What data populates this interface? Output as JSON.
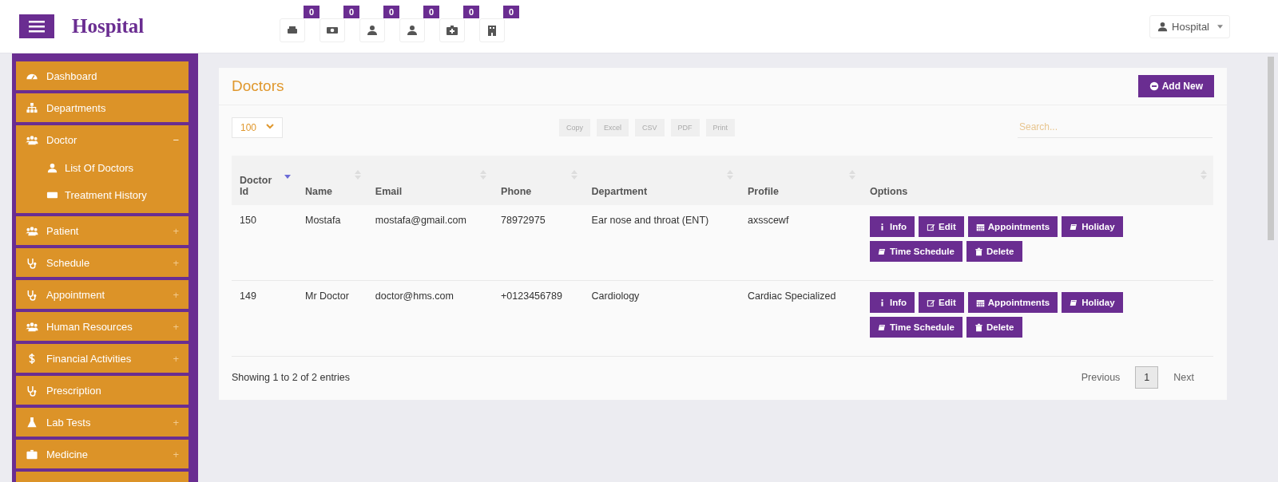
{
  "header": {
    "brand": "Hospital",
    "notifications": [
      {
        "kind": "printer",
        "count": "0"
      },
      {
        "kind": "money",
        "count": "0"
      },
      {
        "kind": "user",
        "count": "0"
      },
      {
        "kind": "user",
        "count": "0"
      },
      {
        "kind": "medkit",
        "count": "0"
      },
      {
        "kind": "building",
        "count": "0"
      }
    ],
    "user_menu": "Hospital"
  },
  "sidebar": {
    "items": [
      {
        "kind": "dashboard",
        "label": "Dashboard"
      },
      {
        "kind": "sitemap",
        "label": "Departments"
      },
      {
        "kind": "users",
        "label": "Doctor",
        "toggle": "−",
        "expanded": true,
        "children": [
          {
            "kind": "user",
            "label": "List Of Doctors"
          },
          {
            "kind": "money",
            "label": "Treatment History"
          }
        ]
      },
      {
        "kind": "users",
        "label": "Patient",
        "toggle": "+",
        "expanded": false
      },
      {
        "kind": "stethoscope",
        "label": "Schedule",
        "toggle": "+",
        "expanded": false
      },
      {
        "kind": "stethoscope",
        "label": "Appointment",
        "toggle": "+",
        "expanded": false
      },
      {
        "kind": "users",
        "label": "Human Resources",
        "toggle": "+",
        "expanded": false
      },
      {
        "kind": "dollar",
        "label": "Financial Activities",
        "toggle": "+",
        "expanded": false
      },
      {
        "kind": "stethoscope",
        "label": "Prescription"
      },
      {
        "kind": "flask",
        "label": "Lab Tests",
        "toggle": "+",
        "expanded": false
      },
      {
        "kind": "medkit",
        "label": "Medicine",
        "toggle": "+",
        "expanded": false
      },
      {
        "kind": "cut"
      }
    ]
  },
  "panel": {
    "title": "Doctors",
    "add_button": "Add New",
    "page_size": "100",
    "export_buttons": [
      "Copy",
      "Excel",
      "CSV",
      "PDF",
      "Print"
    ],
    "search": {
      "placeholder": "Search..."
    },
    "table": {
      "columns": [
        {
          "label": "Doctor Id",
          "sorted": true
        },
        {
          "label": "Name",
          "sorted": false
        },
        {
          "label": "Email",
          "sorted": false
        },
        {
          "label": "Phone",
          "sorted": false
        },
        {
          "label": "Department",
          "sorted": false
        },
        {
          "label": "Profile",
          "sorted": false
        },
        {
          "label": "Options",
          "sorted": false
        }
      ],
      "rows": [
        {
          "cells": [
            "150",
            "Mostafa",
            "mostafa@gmail.com",
            "78972975",
            "Ear nose and throat (ENT)",
            "axsscewf"
          ],
          "actions": [
            {
              "kind": "info",
              "label": "Info"
            },
            {
              "kind": "edit",
              "label": "Edit"
            },
            {
              "kind": "calendar",
              "label": "Appointments"
            },
            {
              "kind": "book",
              "label": "Holiday"
            },
            {
              "kind": "book",
              "label": "Time Schedule"
            },
            {
              "kind": "trash",
              "label": "Delete"
            }
          ]
        },
        {
          "cells": [
            "149",
            "Mr Doctor",
            "doctor@hms.com",
            "+0123456789",
            "Cardiology",
            "Cardiac Specialized"
          ],
          "actions": [
            {
              "kind": "info",
              "label": "Info"
            },
            {
              "kind": "edit",
              "label": "Edit"
            },
            {
              "kind": "calendar",
              "label": "Appointments"
            },
            {
              "kind": "book",
              "label": "Holiday"
            },
            {
              "kind": "book",
              "label": "Time Schedule"
            },
            {
              "kind": "trash",
              "label": "Delete"
            }
          ]
        }
      ]
    },
    "info": "Showing 1 to 2 of 2 entries",
    "pagination": [
      {
        "label": "Previous",
        "selected": false
      },
      {
        "label": "1",
        "selected": true
      },
      {
        "label": "Next",
        "selected": false
      }
    ]
  }
}
